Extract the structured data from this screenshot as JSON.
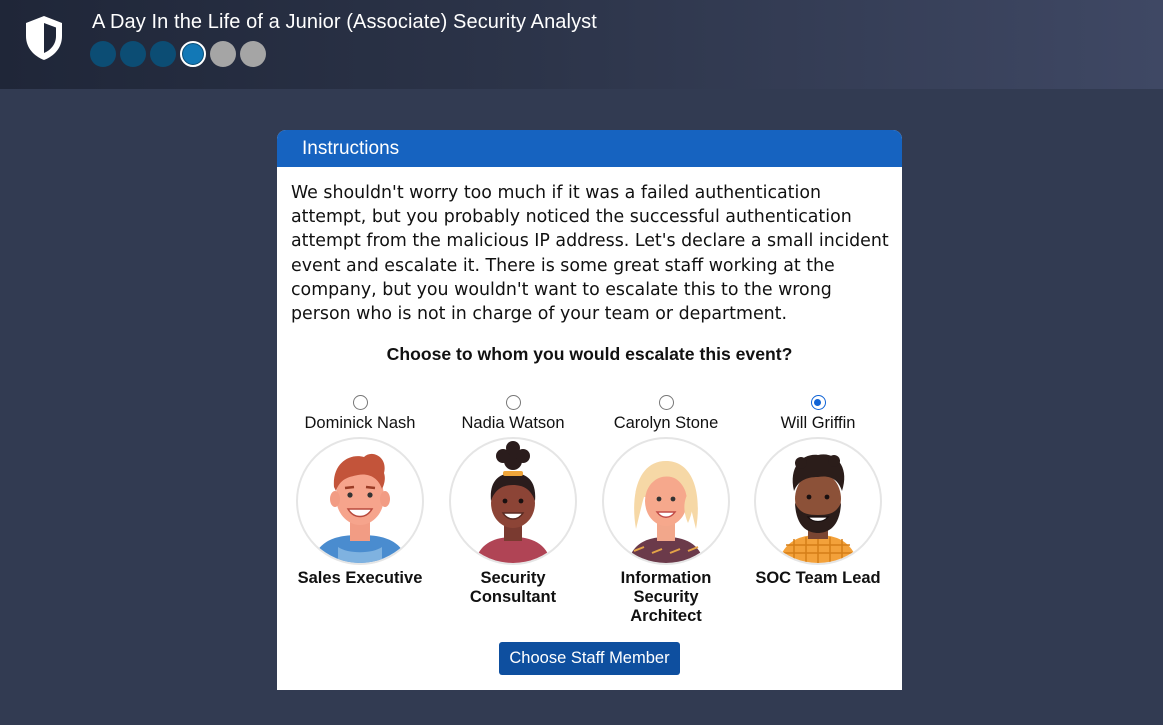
{
  "header": {
    "title": "A Day In the Life of a Junior (Associate) Security Analyst",
    "logo_icon": "shield-icon",
    "progress": {
      "total": 6,
      "current": 4,
      "completed": 3
    }
  },
  "card": {
    "heading": "Instructions",
    "body": "We shouldn't worry too much if it was a failed authentication attempt, but you probably noticed the successful authentication attempt from the malicious IP address. Let's declare a small incident event and escalate it. There is some great staff working at the company, but you wouldn't want to escalate this to the wrong person who is not in charge of your team or department.",
    "question": "Choose to whom you would escalate this event?",
    "staff": [
      {
        "name": "Dominick Nash",
        "role": "Sales Executive",
        "selected": false
      },
      {
        "name": "Nadia Watson",
        "role": "Security Consultant",
        "selected": false
      },
      {
        "name": "Carolyn Stone",
        "role": "Information Security Architect",
        "selected": false
      },
      {
        "name": "Will Griffin",
        "role": "SOC Team Lead",
        "selected": true
      }
    ],
    "button_label": "Choose Staff Member"
  },
  "colors": {
    "background": "#323b52",
    "header_accent": "#1663c0",
    "button": "#0e4f9f",
    "progress_done": "#0c4d74",
    "progress_current": "#1278b6",
    "progress_todo": "#a5a5a5"
  }
}
